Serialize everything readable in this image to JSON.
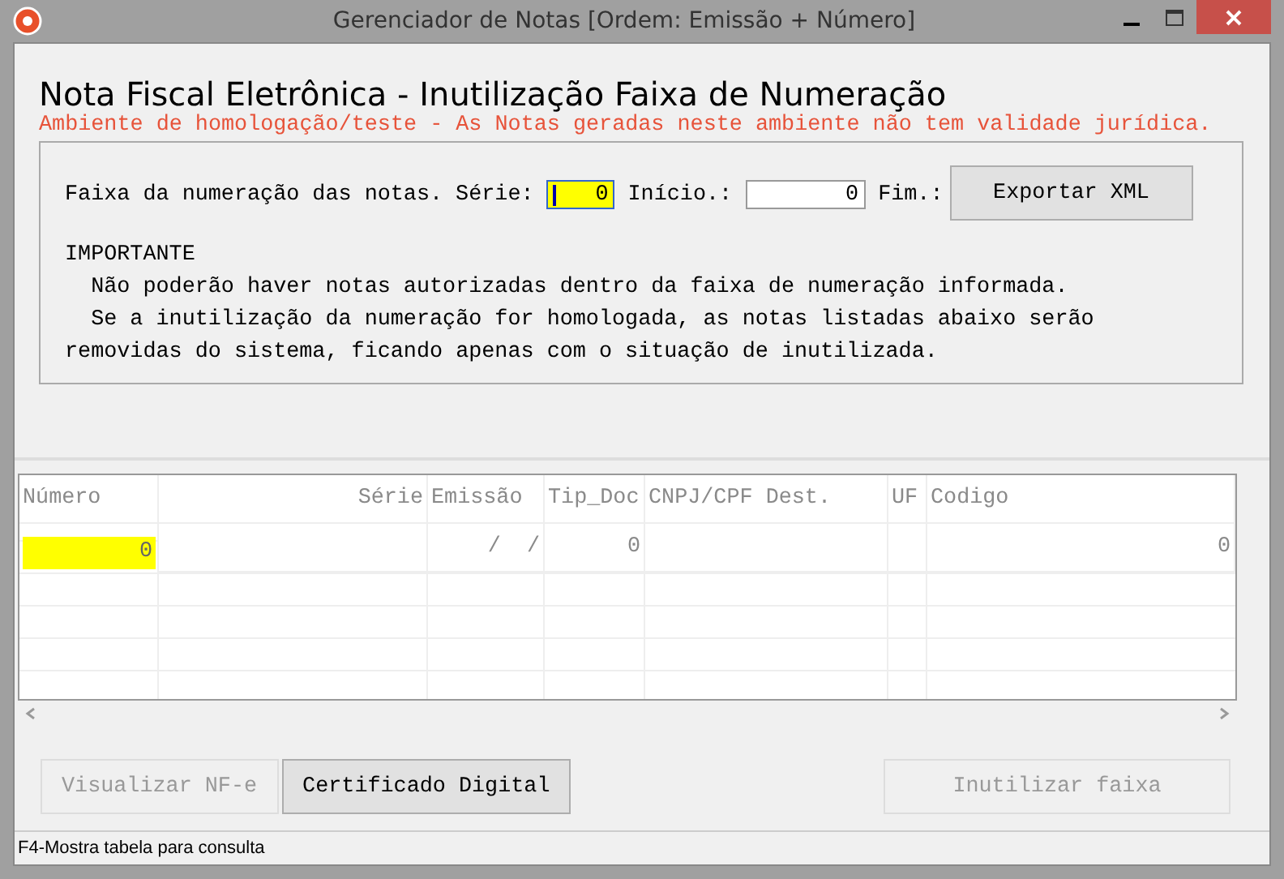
{
  "window": {
    "title": "Gerenciador de Notas [Ordem: Emissão + Número]"
  },
  "heading": "Nota Fiscal Eletrônica - Inutilização Faixa de Numeração",
  "warning": "Ambiente de homologação/teste - As Notas geradas neste ambiente não tem validade jurídica.",
  "range": {
    "label": "Faixa da numeração das notas.",
    "fields": [
      {
        "label": "Série:",
        "value": "0",
        "focused": true
      },
      {
        "label": "Início.:",
        "value": "0",
        "focused": false
      },
      {
        "label": "Fim.:"
      }
    ],
    "export_button": "Exportar XML"
  },
  "notice": {
    "title": "IMPORTANTE",
    "lines": [
      "  Não poderão haver notas autorizadas dentro da faixa de numeração informada.",
      "  Se a inutilização da numeração for homologada, as notas listadas abaixo serão",
      "removidas do sistema, ficando apenas com o situação de inutilizada."
    ]
  },
  "table": {
    "columns": [
      "Número",
      "Série",
      "Emissão",
      "Tip_Doc",
      "CNPJ/CPF Dest.",
      "UF",
      "Codigo"
    ],
    "rows": [
      {
        "cells": [
          "0",
          "",
          "  /  /",
          "0",
          "",
          "",
          "0"
        ],
        "selected": true
      }
    ]
  },
  "buttons": [
    {
      "label": "Visualizar NF-e",
      "disabled": true
    },
    {
      "label": "Certificado Digital",
      "disabled": false
    },
    {
      "label": "Inutilizar faixa",
      "disabled": true
    }
  ],
  "status_bar": "F4-Mostra tabela para consulta"
}
